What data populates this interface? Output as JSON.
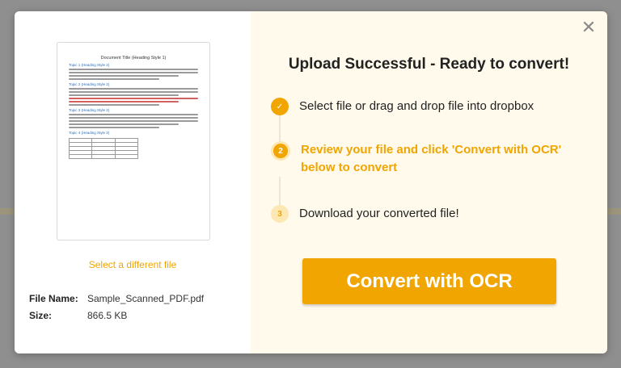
{
  "modal": {
    "heading": "Upload Successful - Ready to convert!",
    "close_icon": "close-icon",
    "select_link": "Select a different file",
    "file": {
      "name_label": "File Name:",
      "name_value": "Sample_Scanned_PDF.pdf",
      "size_label": "Size:",
      "size_value": "866.5 KB"
    },
    "steps": [
      {
        "marker": "✓",
        "text": "Select file or drag and drop file into dropbox",
        "state": "done"
      },
      {
        "marker": "2",
        "text": "Review your file and click 'Convert with OCR' below to convert",
        "state": "active"
      },
      {
        "marker": "3",
        "text": "Download your converted file!",
        "state": "future"
      }
    ],
    "convert_label": "Convert with OCR"
  },
  "preview": {
    "title": "Document Title (Heading Style 1)",
    "headings": [
      "Topic 1 (Heading Style 2)",
      "Topic 2 (Heading Style 2)",
      "Topic 3 (Heading Style 2)",
      "Topic 4 (Heading Style 2)"
    ]
  },
  "colors": {
    "accent": "#f0a500",
    "accent_light": "#fde7b3",
    "right_panel_bg": "#fffaec"
  }
}
